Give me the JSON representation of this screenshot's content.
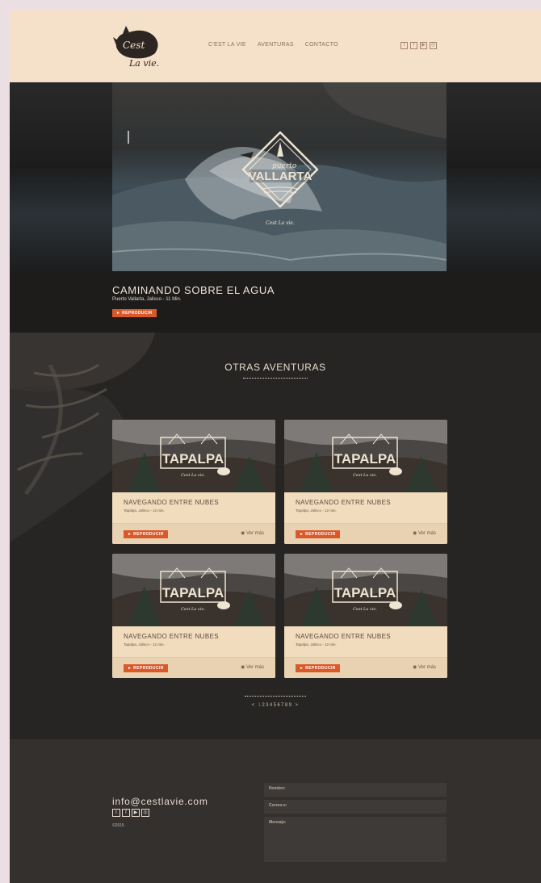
{
  "header": {
    "logo_text": "Cest La vie.",
    "nav": [
      "C'EST LA VIE",
      "AVENTURAS",
      "CONTACTO"
    ],
    "social_icons": [
      "twitter-icon",
      "facebook-icon",
      "youtube-icon",
      "instagram-icon"
    ]
  },
  "hero": {
    "badge_line1": "puerto",
    "badge_line2": "VALLARTA",
    "signature": "Cest La vie.",
    "title": "CAMINANDO SOBRE EL AGUA",
    "subtitle": "Puerto Vallarta, Jalisco - 11 Min.",
    "play_label": "► REPRODUCIR"
  },
  "otras": {
    "title": "OTRAS AVENTURAS",
    "cards": [
      {
        "badge": "TAPALPA",
        "signature": "Cest La vie.",
        "title": "NAVEGANDO ENTRE NUBES",
        "subtitle": "Tapalpa, Jalisco - 12 min.",
        "play_label": "► REPRODUCIR",
        "more_label": "Ver más"
      },
      {
        "badge": "TAPALPA",
        "signature": "Cest La vie.",
        "title": "NAVEGANDO ENTRE NUBES",
        "subtitle": "Tapalpa, Jalisco - 12 min.",
        "play_label": "► REPRODUCIR",
        "more_label": "Ver más"
      },
      {
        "badge": "TAPALPA",
        "signature": "Cest La vie.",
        "title": "NAVEGANDO ENTRE NUBES",
        "subtitle": "Tapalpa, Jalisco - 12 min.",
        "play_label": "► REPRODUCIR",
        "more_label": "Ver más"
      },
      {
        "badge": "TAPALPA",
        "signature": "Cest La vie.",
        "title": "NAVEGANDO ENTRE NUBES",
        "subtitle": "Tapalpa, Jalisco - 12 min.",
        "play_label": "► REPRODUCIR",
        "more_label": "Ver más"
      }
    ],
    "pager": {
      "prev": "<",
      "pages": [
        "1",
        "2",
        "3",
        "4",
        "5",
        "6",
        "7",
        "8",
        "9"
      ],
      "current": "1",
      "next": ">"
    }
  },
  "footer": {
    "email": "info@cestlavie.com",
    "copyright": "©2015",
    "form": {
      "name_placeholder": "Nombre:",
      "email_placeholder": "Correo-e:",
      "message_placeholder": "Mensaje:"
    }
  },
  "colors": {
    "accent": "#d9592b",
    "header_bg": "#f5e1c9",
    "card_bg": "#f1dcbd"
  }
}
